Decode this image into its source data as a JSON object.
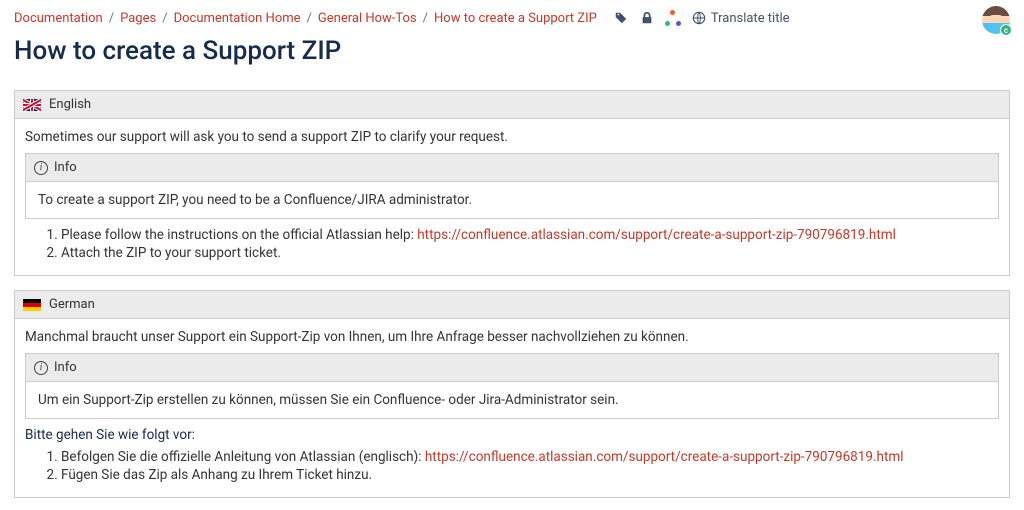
{
  "breadcrumbs": {
    "items": [
      {
        "label": "Documentation"
      },
      {
        "label": "Pages"
      },
      {
        "label": "Documentation Home"
      },
      {
        "label": "General How-Tos"
      },
      {
        "label": "How to create a Support ZIP"
      }
    ],
    "separator": "/"
  },
  "toolbar": {
    "translate_label": "Translate title"
  },
  "avatar": {
    "badge": "c"
  },
  "page": {
    "title": "How to create a Support ZIP"
  },
  "blocks": {
    "english": {
      "header": "English",
      "intro": "Sometimes our support will ask you to send a support ZIP to clarify your request.",
      "info_title": "Info",
      "info_body": "To create a support ZIP, you need to be a Confluence/JIRA administrator.",
      "steps": {
        "s1_prefix": "Please follow the instructions on the official Atlassian help: ",
        "s1_link": "https://confluence.atlassian.com/support/create-a-support-zip-790796819.html",
        "s2": "Attach the ZIP to your support ticket."
      }
    },
    "german": {
      "header": "German",
      "intro": "Manchmal braucht unser Support ein Support-Zip von Ihnen, um Ihre Anfrage besser nachvollziehen zu können.",
      "info_title": "Info",
      "info_body": "Um ein Support-Zip erstellen zu können, müssen Sie ein Confluence- oder Jira-Administrator sein.",
      "pretext": "Bitte gehen Sie wie folgt vor:",
      "steps": {
        "s1_prefix": "Befolgen Sie die offizielle Anleitung von Atlassian (englisch): ",
        "s1_link": "https://confluence.atlassian.com/support/create-a-support-zip-790796819.html",
        "s2": "Fügen Sie das Zip als Anhang zu Ihrem Ticket hinzu."
      }
    }
  }
}
